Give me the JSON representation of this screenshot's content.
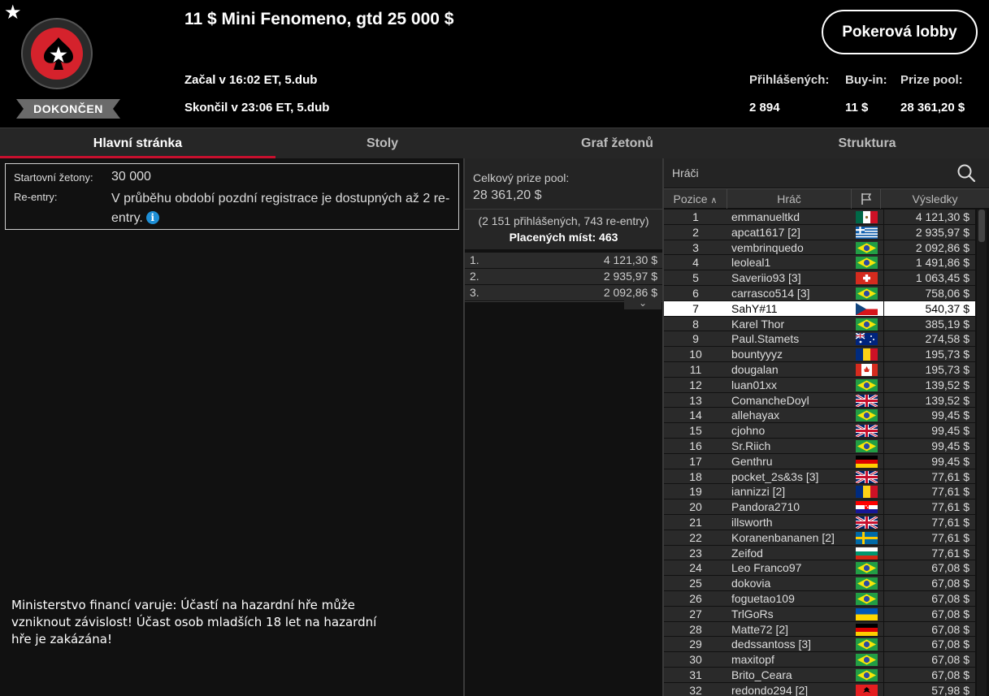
{
  "header": {
    "favorite_icon": "star-icon",
    "logo": "pokerstars-spade-logo",
    "status": "DOKONČEN",
    "title": "11 $ Mini Fenomeno,  gtd 25 000 $",
    "started": "Začal v 16:02 ET, 5.dub",
    "finished": "Skončil v 23:06 ET, 5.dub",
    "lobby_button": "Pokerová lobby",
    "stats": {
      "registered_label": "Přihlášených:",
      "registered_value": "2 894",
      "buyin_label": "Buy-in:",
      "buyin_value": "11 $",
      "prizepool_label": "Prize pool:",
      "prizepool_value": "28 361,20 $"
    }
  },
  "tabs": [
    "Hlavní stránka",
    "Stoly",
    "Graf žetonů",
    "Struktura"
  ],
  "info": {
    "chips_label": "Startovní žetony:",
    "chips_value": "30 000",
    "reentry_label": "Re-entry:",
    "reentry_value": "V průběhu období pozdní registrace je dostupných až 2 re-entry.",
    "info_icon": "i"
  },
  "warning": "Ministerstvo financí varuje: Účastí na hazardní hře může vzniknout závislost! Účast osob mladších 18 let na hazardní hře je zakázána!",
  "prizepool": {
    "label": "Celkový prize pool:",
    "value": "28 361,20 $",
    "entries": "(2 151 přihlášených, 743 re-entry)",
    "paid": "Placených míst: 463",
    "payouts": [
      {
        "place": "1.",
        "amount": "4 121,30 $"
      },
      {
        "place": "2.",
        "amount": "2 935,97 $"
      },
      {
        "place": "3.",
        "amount": "2 092,86 $"
      }
    ],
    "expand_icon": "chevron-down-icon"
  },
  "players": {
    "search_label": "Hráči",
    "columns": {
      "position": "Pozice",
      "player": "Hráč",
      "flag_icon": "flag-icon",
      "results": "Výsledky"
    },
    "highlight_position": "7",
    "rows": [
      {
        "pos": "1",
        "name": "emmanueltkd",
        "flag": "mx",
        "result": "4 121,30 $"
      },
      {
        "pos": "2",
        "name": "apcat1617 [2]",
        "flag": "gr",
        "result": "2 935,97 $"
      },
      {
        "pos": "3",
        "name": "vembrinquedo",
        "flag": "br",
        "result": "2 092,86 $"
      },
      {
        "pos": "4",
        "name": "leoleal1",
        "flag": "br",
        "result": "1 491,86 $"
      },
      {
        "pos": "5",
        "name": "Saveriio93 [3]",
        "flag": "ch",
        "result": "1 063,45 $"
      },
      {
        "pos": "6",
        "name": "carrasco514 [3]",
        "flag": "br",
        "result": "758,06 $"
      },
      {
        "pos": "7",
        "name": "SahY#11",
        "flag": "cz",
        "result": "540,37 $"
      },
      {
        "pos": "8",
        "name": "Karel Thor",
        "flag": "br",
        "result": "385,19 $"
      },
      {
        "pos": "9",
        "name": "Paul.Stamets",
        "flag": "au",
        "result": "274,58 $"
      },
      {
        "pos": "10",
        "name": "bountyyyz",
        "flag": "ro",
        "result": "195,73 $"
      },
      {
        "pos": "11",
        "name": "dougalan",
        "flag": "ca",
        "result": "195,73 $"
      },
      {
        "pos": "12",
        "name": "luan01xx",
        "flag": "br",
        "result": "139,52 $"
      },
      {
        "pos": "13",
        "name": "ComancheDoyl",
        "flag": "gb",
        "result": "139,52 $"
      },
      {
        "pos": "14",
        "name": "allehayax",
        "flag": "br",
        "result": "99,45 $"
      },
      {
        "pos": "15",
        "name": "cjohno",
        "flag": "gb",
        "result": "99,45 $"
      },
      {
        "pos": "16",
        "name": "Sr.Riich",
        "flag": "br",
        "result": "99,45 $"
      },
      {
        "pos": "17",
        "name": "Genthru",
        "flag": "de",
        "result": "99,45 $"
      },
      {
        "pos": "18",
        "name": "pocket_2s&3s [3]",
        "flag": "gb",
        "result": "77,61 $"
      },
      {
        "pos": "19",
        "name": "iannizzi [2]",
        "flag": "ro",
        "result": "77,61 $"
      },
      {
        "pos": "20",
        "name": "Pandora2710",
        "flag": "hr",
        "result": "77,61 $"
      },
      {
        "pos": "21",
        "name": "illsworth",
        "flag": "gb",
        "result": "77,61 $"
      },
      {
        "pos": "22",
        "name": "Koranenbananen [2]",
        "flag": "se",
        "result": "77,61 $"
      },
      {
        "pos": "23",
        "name": "Zeifod",
        "flag": "bg",
        "result": "77,61 $"
      },
      {
        "pos": "24",
        "name": "Leo Franco97",
        "flag": "br",
        "result": "67,08 $"
      },
      {
        "pos": "25",
        "name": "dokovia",
        "flag": "br",
        "result": "67,08 $"
      },
      {
        "pos": "26",
        "name": "foguetao109",
        "flag": "br",
        "result": "67,08 $"
      },
      {
        "pos": "27",
        "name": "TrlGoRs",
        "flag": "ua",
        "result": "67,08 $"
      },
      {
        "pos": "28",
        "name": "Matte72 [2]",
        "flag": "de",
        "result": "67,08 $"
      },
      {
        "pos": "29",
        "name": "dedssantoss [3]",
        "flag": "br",
        "result": "67,08 $"
      },
      {
        "pos": "30",
        "name": "maxitopf",
        "flag": "br",
        "result": "67,08 $"
      },
      {
        "pos": "31",
        "name": "Brito_Ceara",
        "flag": "br",
        "result": "67,08 $"
      },
      {
        "pos": "32",
        "name": "redondo294 [2]",
        "flag": "al",
        "result": "57,98 $"
      }
    ]
  },
  "colors": {
    "accent": "#c8102e",
    "logo_red": "#d5222c",
    "panel": "#2a2a2a",
    "background": "#000000"
  }
}
